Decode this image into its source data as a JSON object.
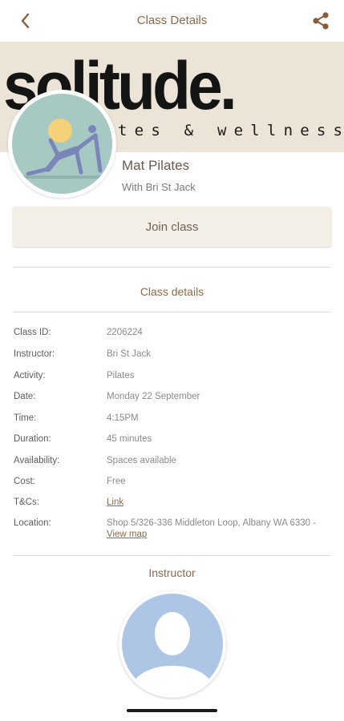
{
  "topbar": {
    "title": "Class Details",
    "back_icon": "chevron-left-icon",
    "share_icon": "share-icon"
  },
  "banner": {
    "brand": "solitude.",
    "tagline": "tes & wellness"
  },
  "class": {
    "name": "Mat Pilates",
    "instructor_line": "With Bri St Jack"
  },
  "join_label": "Join class",
  "details_title": "Class details",
  "details": [
    {
      "label": "Class ID:",
      "value": "2206224"
    },
    {
      "label": "Instructor:",
      "value": "Bri St Jack"
    },
    {
      "label": "Activity:",
      "value": "Pilates"
    },
    {
      "label": "Date:",
      "value": "Monday 22 September"
    },
    {
      "label": "Time:",
      "value": "4:15PM"
    },
    {
      "label": "Duration:",
      "value": "45 minutes"
    },
    {
      "label": "Availability:",
      "value": "Spaces available"
    },
    {
      "label": "Cost:",
      "value": "Free"
    },
    {
      "label": "T&Cs:",
      "link": "Link"
    },
    {
      "label": "Location:",
      "value": "Shop 5/326-336 Middleton Loop, Albany WA 6330 -",
      "link": "View map"
    }
  ],
  "instructor_title": "Instructor",
  "colors": {
    "accent": "#8a6a4a",
    "banner_bg": "#ece4d6",
    "join_bg": "#f4efe6",
    "class_avatar_bg": "#a7c9c4",
    "instructor_avatar_bg": "#aec6e6"
  }
}
